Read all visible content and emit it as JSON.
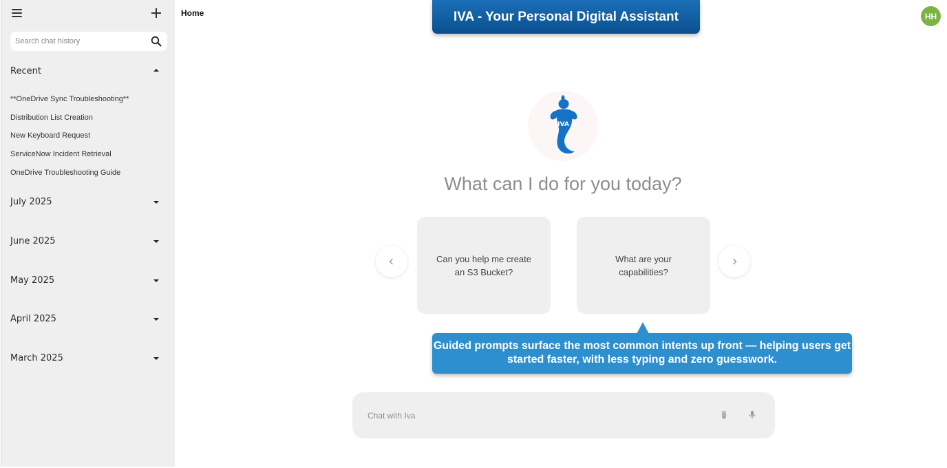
{
  "sidebar": {
    "menu_icon": "hamburger-menu-icon",
    "new_chat_icon": "plus-icon",
    "search": {
      "placeholder": "Search chat history",
      "value": "",
      "icon": "search-icon"
    },
    "recent": {
      "label": "Recent",
      "expanded": true,
      "items": [
        "**OneDrive Sync Troubleshooting**",
        "Distribution List Creation",
        "New Keyboard Request",
        "ServiceNow Incident Retrieval",
        "OneDrive Troubleshooting Guide"
      ]
    },
    "months": [
      {
        "label": "July 2025",
        "expanded": false
      },
      {
        "label": "June 2025",
        "expanded": false
      },
      {
        "label": "May 2025",
        "expanded": false
      },
      {
        "label": "April 2025",
        "expanded": false
      },
      {
        "label": "March 2025",
        "expanded": false
      }
    ]
  },
  "header": {
    "breadcrumb": "Home",
    "banner": "IVA - Your Personal Digital Assistant",
    "avatar_initials": "HH"
  },
  "main": {
    "logo_text": "IVA",
    "heading": "What can I do for you today?",
    "prompts": [
      "Can you help me create an S3 Bucket?",
      "What are your capabilities?"
    ],
    "callout": "Guided prompts surface the most common intents up front — helping users get started faster, with less typing and zero guesswork.",
    "chat": {
      "placeholder": "Chat with Iva",
      "value": "",
      "attach_icon": "paperclip-icon",
      "mic_icon": "microphone-icon"
    }
  },
  "colors": {
    "banner": "#0a4f8f",
    "callout": "#2e8fcf",
    "avatar": "#7cb342",
    "logo_blue": "#1473c6",
    "sidebar_bg": "#efefef"
  }
}
